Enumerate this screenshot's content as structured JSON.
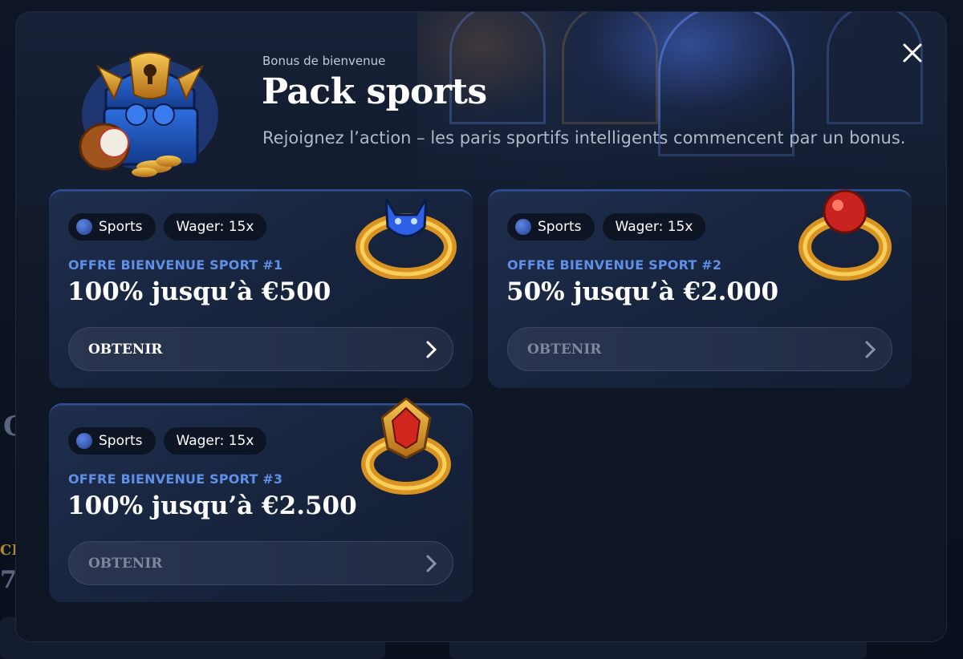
{
  "header": {
    "subtitle": "Bonus de bienvenue",
    "title": "Pack sports",
    "tagline": "Rejoignez l’action – les paris sportifs intelligents commencent par un bonus."
  },
  "close_icon": "close-icon",
  "offers": [
    {
      "category": "Sports",
      "wager": "Wager: 15x",
      "label": "OFFRE BIENVENUE SPORT #1",
      "value": "100% jusqu’à €500",
      "button": "OBTENIR",
      "icon": "demon-ring-icon",
      "button_active": true
    },
    {
      "category": "Sports",
      "wager": "Wager: 15x",
      "label": "OFFRE BIENVENUE SPORT #2",
      "value": "50% jusqu’à €2.000",
      "button": "OBTENIR",
      "icon": "red-orb-ring-icon",
      "button_active": false
    },
    {
      "category": "Sports",
      "wager": "Wager: 15x",
      "label": "OFFRE BIENVENUE SPORT #3",
      "value": "100% jusqu’à €2.500",
      "button": "OBTENIR",
      "icon": "ruby-ring-icon",
      "button_active": false
    }
  ],
  "colors": {
    "accent_label": "#5f8fe6",
    "modal_bg": "#121a2c",
    "card_bg": "#1a2842",
    "gold": "#e0a22a"
  }
}
